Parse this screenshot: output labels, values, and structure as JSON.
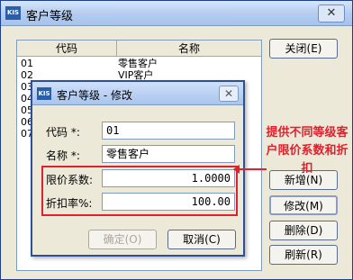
{
  "main_window": {
    "title": "客户等级",
    "logo": "KIS",
    "close_glyph": "✕"
  },
  "list": {
    "headers": [
      "代码",
      "名称"
    ],
    "rows": [
      {
        "code": "01",
        "name": "零售客户"
      },
      {
        "code": "02",
        "name": "VIP客户"
      },
      {
        "code": "03",
        "name": ""
      },
      {
        "code": "04",
        "name": ""
      },
      {
        "code": "05",
        "name": ""
      },
      {
        "code": "06",
        "name": ""
      },
      {
        "code": "07",
        "name": ""
      }
    ]
  },
  "side_buttons": {
    "close": "关闭(E)",
    "add": "新增(N)",
    "modify": "修改(M)",
    "delete": "删除(D)",
    "refresh": "刷新(R)"
  },
  "dialog": {
    "title": "客户等级 - 修改",
    "logo": "KIS",
    "close_glyph": "✕",
    "code_label": "代码 *:",
    "code_value": "01",
    "name_label": "名称 *:",
    "name_value": "零售客户",
    "price_coef_label": "限价系数:",
    "price_coef_value": "1.0000",
    "discount_label": "折扣率%:",
    "discount_value": "100.00",
    "ok": "确定(O)",
    "cancel": "取消(C)"
  },
  "annotation": {
    "text": "提供不同等级客户限价系数和折扣",
    "color": "#e0202c"
  }
}
